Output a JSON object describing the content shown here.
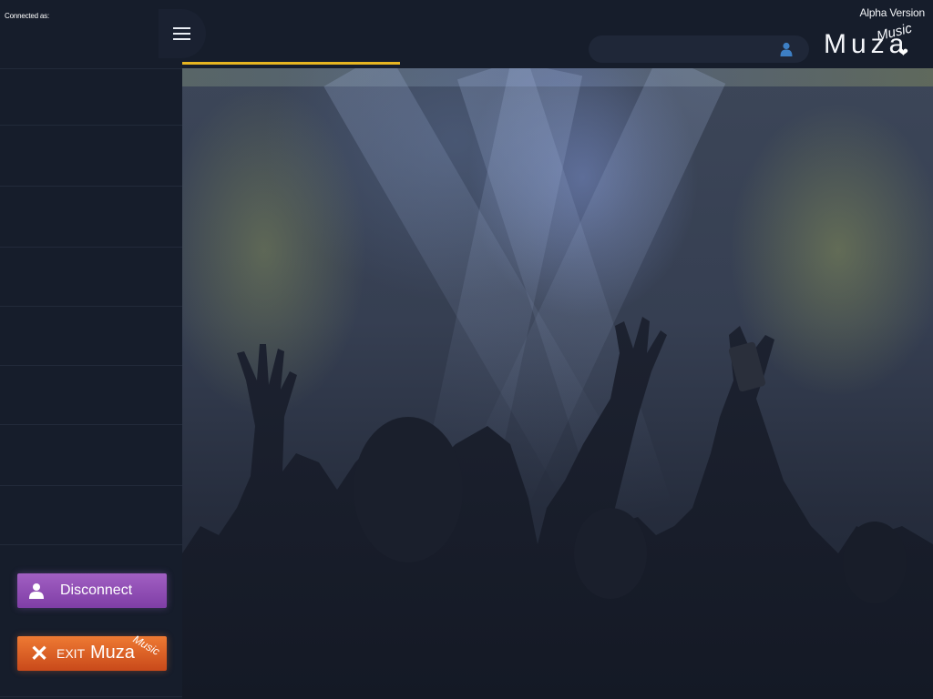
{
  "app": {
    "alpha_label": "Alpha Version",
    "logo": {
      "word": "Muza",
      "script": "Music"
    }
  },
  "sidebar": {
    "connected_as": "Connected as:",
    "disconnect_label": "Disconnect",
    "exit": {
      "prefix": "EXIT",
      "word": "Muza",
      "script": "Music"
    }
  },
  "search": {
    "value": "",
    "placeholder": ""
  },
  "progress": {
    "fraction": 0.29
  },
  "icons": {
    "menu": "hamburger-icon",
    "search_user": "user-icon",
    "disconnect": "user-icon",
    "exit": "close-icon",
    "logo_heart": "heart-icon"
  },
  "colors": {
    "progress": "#e6b521",
    "disconnect": "#8f4db4",
    "exit": "#e06026",
    "background": "#141a27"
  }
}
